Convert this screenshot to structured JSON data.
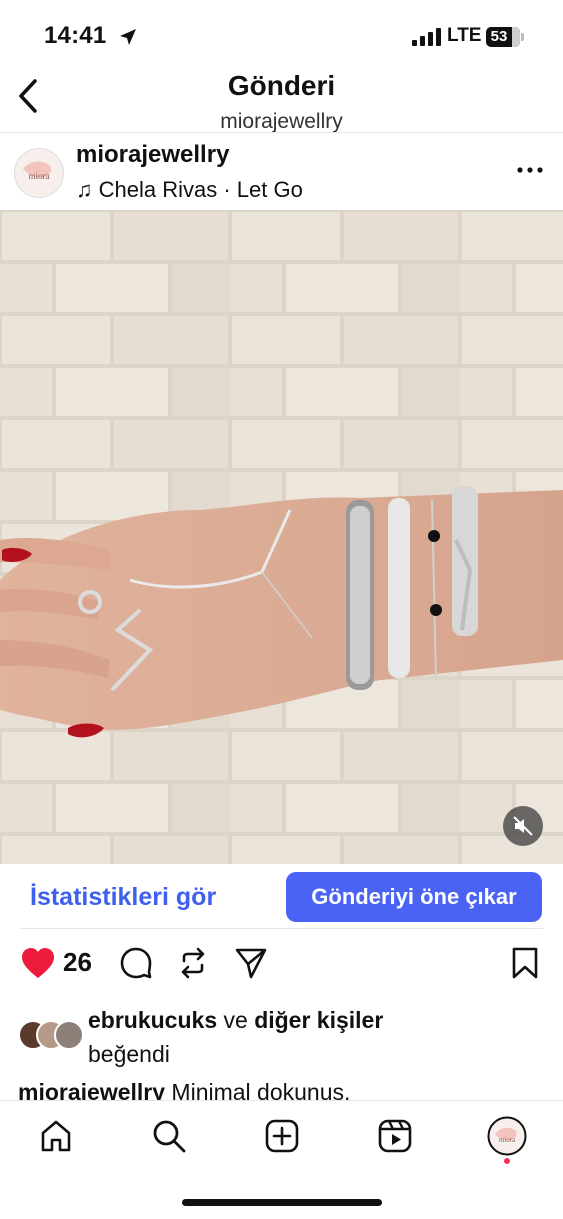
{
  "status_bar": {
    "time": "14:41",
    "network": "LTE",
    "battery": "53"
  },
  "header": {
    "title": "Gönderi",
    "subtitle": "miorajewellry"
  },
  "post": {
    "username": "miorajewellry",
    "music_note": "♫",
    "music": "Chela Rivas · Let Go",
    "avatar_text": "miora"
  },
  "actions": {
    "stats_label": "İstatistikleri gör",
    "promote_label": "Gönderiyi öne çıkar"
  },
  "engagement": {
    "likes": "26"
  },
  "likes_line": {
    "user": "ebrukucuks",
    "connector": " ve ",
    "others": "diğer kişiler",
    "suffix": "beğendi"
  },
  "caption": {
    "user": "miorajewellry",
    "text": " Minimal dokunuş."
  },
  "colors": {
    "accent": "#4a63f5",
    "like": "#ed1c3c",
    "notification": "#ff2d55"
  },
  "icons": [
    "location-arrow-icon",
    "signal-icon",
    "battery-icon",
    "back-chevron-icon",
    "music-note-icon",
    "more-icon",
    "mute-icon",
    "heart-icon",
    "comment-icon",
    "repost-icon",
    "send-icon",
    "bookmark-icon",
    "home-icon",
    "search-icon",
    "create-icon",
    "reels-icon",
    "profile-icon"
  ]
}
